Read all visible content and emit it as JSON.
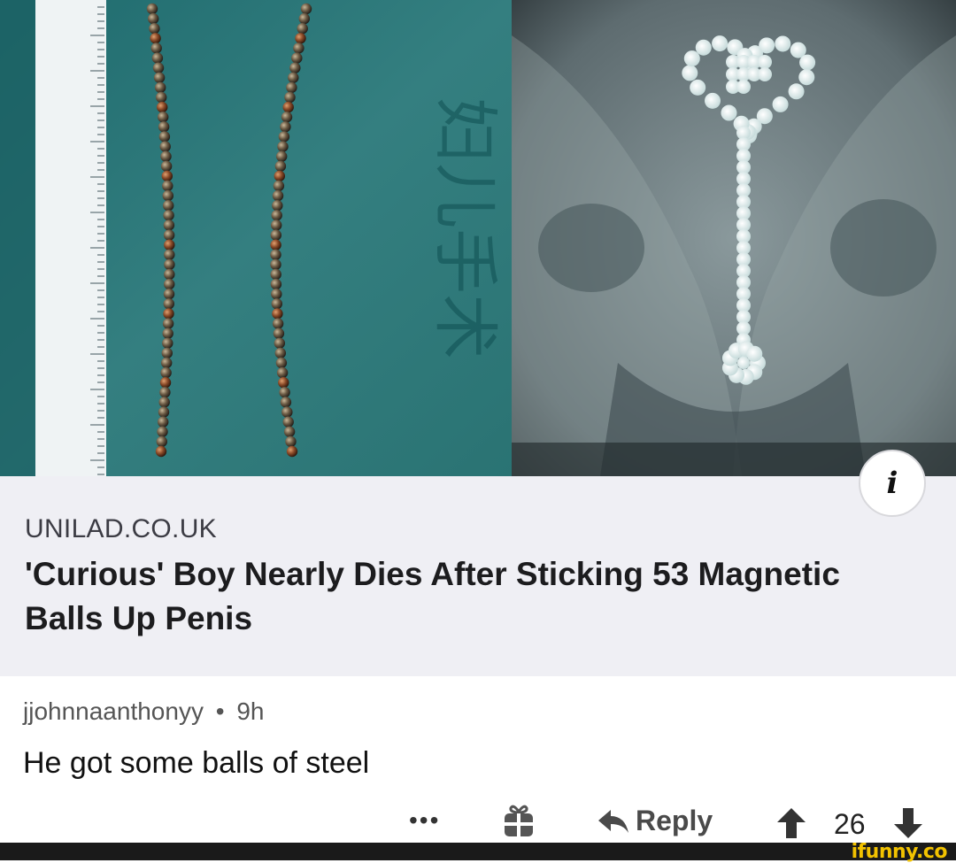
{
  "image": {
    "left_description": "magnetic balls laid out in two rows on a teal surgical cloth with a ruler",
    "left_cloth_text": "妇儿手术",
    "right_description": "x-ray showing chain of balls",
    "info_icon": "i"
  },
  "link_card": {
    "domain": "UNILAD.CO.UK",
    "title": "'Curious' Boy Nearly Dies After Sticking 53 Magnetic Balls Up Penis"
  },
  "comment": {
    "author": "jjohnnaanthonyy",
    "separator": "•",
    "time": "9h",
    "text": "He got some balls of steel"
  },
  "actions": {
    "more_label": "•••",
    "gift_icon": "gift-icon",
    "reply_label": "Reply",
    "score": "26"
  },
  "watermark": "ifunny.co",
  "colors": {
    "cloth": "#2f7c7c",
    "card_bg": "#efeff4",
    "watermark": "#f2c200"
  }
}
